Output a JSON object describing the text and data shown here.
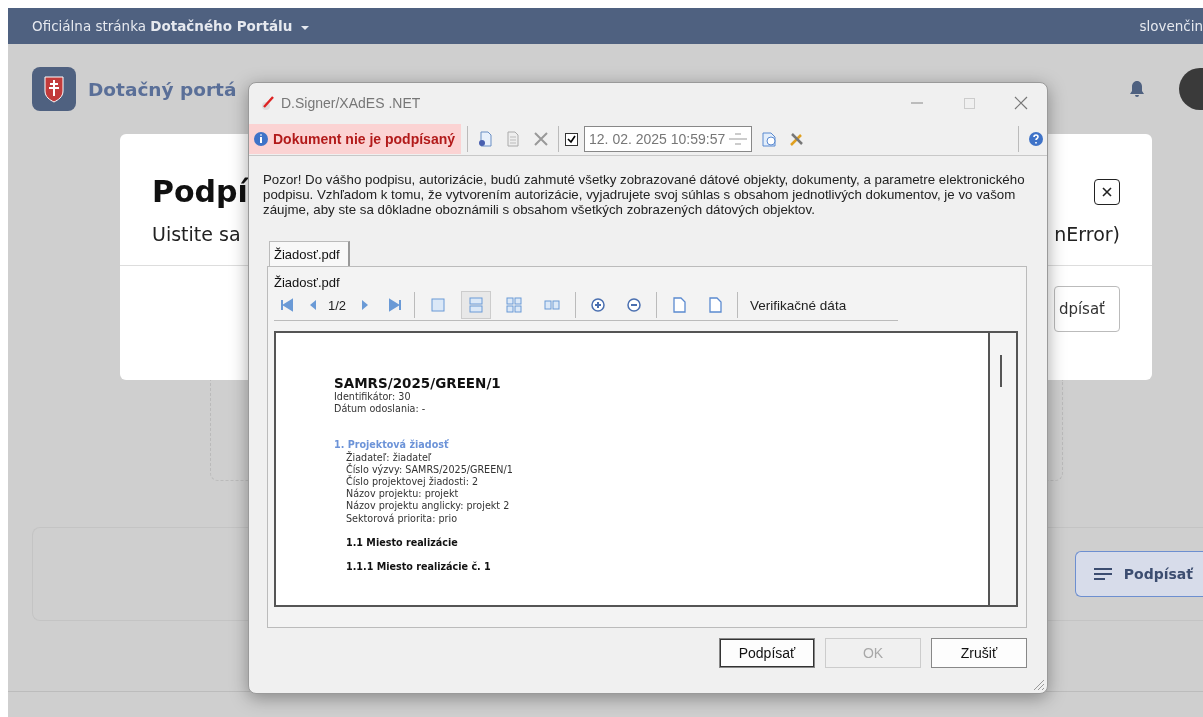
{
  "top_bar": {
    "site_label": "Oficiálna stránka **Dotačného Portálu**",
    "language": "slovenčin"
  },
  "header": {
    "title": "Dotačný portá"
  },
  "modal": {
    "title": "Podpí",
    "text_left": "Uistite sa",
    "text_right": "nError)",
    "button": "dpísať"
  },
  "footer_card": {
    "button": "Podpísať"
  },
  "signer": {
    "title": "D.Signer/XAdES .NET",
    "status": "Dokument nie je podpísaný",
    "timestamp_checked": true,
    "timestamp": "12. 02. 2025 10:59:57",
    "warning": "Pozor! Do vášho podpisu, autorizácie, budú zahmuté všetky zobrazované dátové objekty, dokumenty, a parametre elektronického podpisu. Vzhľadom k tomu, že vytvorením autorizácie, vyjadrujete svoj súhlas s obsahom jednotlivých dokumentov, je vo vašom záujme, aby ste sa dôkladne oboznámili s obsahom všetkých zobrazených dátových objektov.",
    "tabs": [
      {
        "label": "Žiadosť.pdf",
        "selected": true
      }
    ],
    "document_label": "Žiadosť.pdf",
    "page": "1/2",
    "view_modes": [
      {
        "selected": false
      },
      {
        "selected": true
      },
      {
        "selected": false
      },
      {
        "selected": false
      }
    ],
    "verification": "Verifikačné dáta",
    "document": {
      "title": "SAMRS/2025/GREEN/1",
      "meta": [
        "Identifikátor: 30",
        "Dátum odoslania: -"
      ],
      "section": "1. Projektová žiadosť",
      "fields": [
        "Žiadateľ: žiadateľ",
        "Číslo výzvy: SAMRS/2025/GREEN/1",
        "Číslo projektovej žiadosti: 2",
        "Názov projektu: projekt",
        "Názov projektu anglicky: projekt 2",
        "Sektorová priorita: prio"
      ],
      "subheads": [
        "1.1 Miesto realizácie",
        "1.1.1 Miesto realizácie č. 1"
      ]
    },
    "buttons": [
      {
        "label": "Podpísať",
        "disabled": false
      },
      {
        "label": "OK",
        "disabled": true
      },
      {
        "label": "Zrušiť",
        "disabled": false
      }
    ]
  }
}
